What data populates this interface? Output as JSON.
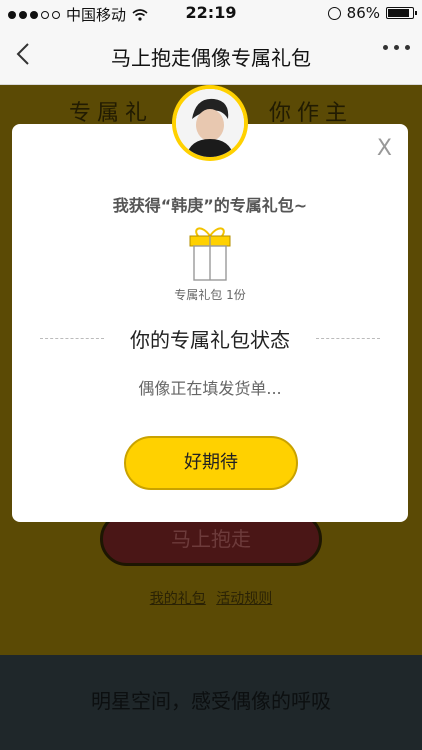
{
  "status_bar": {
    "carrier": "中国移动",
    "time": "22:19",
    "battery": "86%"
  },
  "nav": {
    "title": "马上抱走偶像专属礼包"
  },
  "page": {
    "headline_left": "专属礼",
    "headline_right": "你作主",
    "main_button": "马上抱走",
    "link_my_gift": "我的礼包",
    "link_rules": "活动规则"
  },
  "footer": {
    "slogan": "明星空间，感受偶像的呼吸"
  },
  "modal": {
    "close": "X",
    "title": "我获得“韩庚”的专属礼包~",
    "gift_caption": "专属礼包 1份",
    "status_title": "你的专属礼包状态",
    "status_text": "偶像正在填发货单...",
    "button": "好期待"
  },
  "colors": {
    "accent": "#ffd100",
    "overlay_bg": "#5b4a05",
    "footer_bg": "#1f272a"
  },
  "icons": [
    "back-icon",
    "more-icon",
    "gift-icon",
    "close-icon",
    "avatar"
  ]
}
